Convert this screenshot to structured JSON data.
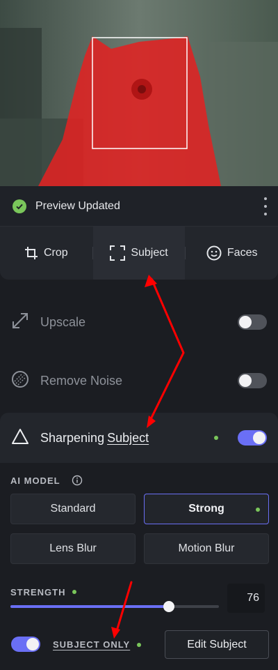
{
  "status": {
    "text": "Preview Updated"
  },
  "tabs": [
    {
      "label": "Crop",
      "icon": "crop-icon"
    },
    {
      "label": "Subject",
      "icon": "subject-frame-icon",
      "active": true
    },
    {
      "label": "Faces",
      "icon": "face-icon"
    }
  ],
  "rows": {
    "upscale": {
      "label": "Upscale",
      "enabled": false
    },
    "remove_noise": {
      "label": "Remove Noise",
      "enabled": false
    }
  },
  "sharpening": {
    "label": "Sharpening",
    "subject_label": "Subject",
    "enabled": true,
    "ai_model_title": "AI MODEL",
    "models": [
      "Standard",
      "Strong",
      "Lens Blur",
      "Motion Blur"
    ],
    "selected_model": "Strong",
    "strength_title": "STRENGTH",
    "strength_value": "76",
    "strength_fraction": 0.76,
    "subject_only_label": "SUBJECT ONLY",
    "subject_only_enabled": true,
    "edit_subject_label": "Edit Subject"
  },
  "colors": {
    "accent": "#6a6ff5",
    "success": "#7ac65b",
    "mask": "#e02222",
    "annotation": "#ff0000"
  }
}
